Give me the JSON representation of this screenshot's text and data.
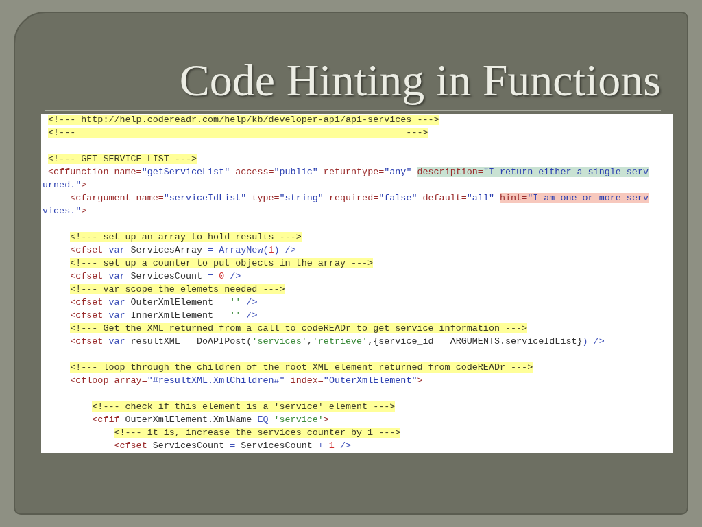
{
  "slide": {
    "title": "Code Hinting in Functions"
  },
  "code": {
    "lines": [
      {
        "segments": [
          {
            "kind": "comment",
            "text": "<!--- http://help.codereadr.com/help/kb/developer-api/api-services --->"
          }
        ]
      },
      {
        "segments": [
          {
            "kind": "comment",
            "text": "<!---                                                            --->"
          }
        ]
      },
      {
        "space_before": true,
        "segments": [
          {
            "kind": "comment",
            "text": "<!--- GET SERVICE LIST --->"
          }
        ]
      },
      {
        "segments": [
          {
            "kind": "tag",
            "text": "<cffunction "
          },
          {
            "kind": "attr",
            "text": "name="
          },
          {
            "kind": "str",
            "text": "\"getServiceList\" "
          },
          {
            "kind": "attr",
            "text": "access="
          },
          {
            "kind": "str",
            "text": "\"public\" "
          },
          {
            "kind": "attr",
            "text": "returntype="
          },
          {
            "kind": "str",
            "text": "\"any\" "
          },
          {
            "kind": "attr",
            "text": "description=",
            "color": "#c9e2d3"
          },
          {
            "kind": "str",
            "text": "\"I return either a single serv",
            "color": "#c9e2d3"
          }
        ],
        "children": [
          {
            "kind": "wrap",
            "segments": [
              {
                "kind": "str",
                "text": "urned.\""
              },
              {
                "kind": "tag",
                "text": ">"
              }
            ]
          },
          {
            "segments": [
              {
                "kind": "tag",
                "text": "<cfargument "
              },
              {
                "kind": "attr",
                "text": "name="
              },
              {
                "kind": "str",
                "text": "\"serviceIdList\" "
              },
              {
                "kind": "attr",
                "text": "type="
              },
              {
                "kind": "str",
                "text": "\"string\" "
              },
              {
                "kind": "attr",
                "text": "required="
              },
              {
                "kind": "str",
                "text": "\"false\" "
              },
              {
                "kind": "attr",
                "text": "default="
              },
              {
                "kind": "str",
                "text": "\"all\" "
              },
              {
                "kind": "attr",
                "text": "hint=",
                "color": "#f7c8bd"
              },
              {
                "kind": "str",
                "text": "\"I am one or more serv",
                "color": "#f7c8bd"
              }
            ]
          },
          {
            "kind": "wrap",
            "segments": [
              {
                "kind": "str",
                "text": "vices.\""
              },
              {
                "kind": "tag",
                "text": ">"
              }
            ]
          },
          {
            "space_before": true,
            "segments": [
              {
                "kind": "comment",
                "text": "<!--- set up an array to hold results --->"
              }
            ]
          },
          {
            "segments": [
              {
                "kind": "tag",
                "text": "<cfset "
              },
              {
                "kind": "kw",
                "text": "var "
              },
              {
                "kind": "text",
                "text": "ServicesArray "
              },
              {
                "kind": "kw",
                "text": "= ArrayNew("
              },
              {
                "kind": "num",
                "text": "1"
              },
              {
                "kind": "kw",
                "text": ") />"
              }
            ]
          },
          {
            "segments": [
              {
                "kind": "comment",
                "text": "<!--- set up a counter to put objects in the array --->"
              }
            ]
          },
          {
            "segments": [
              {
                "kind": "tag",
                "text": "<cfset "
              },
              {
                "kind": "kw",
                "text": "var "
              },
              {
                "kind": "text",
                "text": "ServicesCount "
              },
              {
                "kind": "kw",
                "text": "= "
              },
              {
                "kind": "num",
                "text": "0"
              },
              {
                "kind": "kw",
                "text": " />"
              }
            ]
          },
          {
            "segments": [
              {
                "kind": "comment",
                "text": "<!--- var scope the elemets needed --->"
              }
            ]
          },
          {
            "segments": [
              {
                "kind": "tag",
                "text": "<cfset "
              },
              {
                "kind": "kw",
                "text": "var "
              },
              {
                "kind": "text",
                "text": "OuterXmlElement "
              },
              {
                "kind": "kw",
                "text": "= "
              },
              {
                "kind": "sq",
                "text": "''"
              },
              {
                "kind": "kw",
                "text": " />"
              }
            ]
          },
          {
            "segments": [
              {
                "kind": "tag",
                "text": "<cfset "
              },
              {
                "kind": "kw",
                "text": "var "
              },
              {
                "kind": "text",
                "text": "InnerXmlElement "
              },
              {
                "kind": "kw",
                "text": "= "
              },
              {
                "kind": "sq",
                "text": "''"
              },
              {
                "kind": "kw",
                "text": " />"
              }
            ]
          },
          {
            "segments": [
              {
                "kind": "comment",
                "text": "<!--- Get the XML returned from a call to codeREADr to get service information --->"
              }
            ]
          },
          {
            "segments": [
              {
                "kind": "tag",
                "text": "<cfset "
              },
              {
                "kind": "kw",
                "text": "var "
              },
              {
                "kind": "text",
                "text": "resultXML "
              },
              {
                "kind": "kw",
                "text": "= "
              },
              {
                "kind": "text",
                "text": "DoAPIPost("
              },
              {
                "kind": "sq",
                "text": "'services'"
              },
              {
                "kind": "text",
                "text": ","
              },
              {
                "kind": "sq",
                "text": "'retrieve'"
              },
              {
                "kind": "text",
                "text": ",{service_id "
              },
              {
                "kind": "kw",
                "text": "= "
              },
              {
                "kind": "text",
                "text": "ARGUMENTS.serviceIdList}"
              },
              {
                "kind": "kw",
                "text": ") />"
              }
            ]
          },
          {
            "space_before": true,
            "segments": [
              {
                "kind": "comment",
                "text": "<!--- loop through the children of the root XML element returned from codeREADr --->"
              }
            ]
          },
          {
            "segments": [
              {
                "kind": "tag",
                "text": "<cfloop "
              },
              {
                "kind": "attr",
                "text": "array="
              },
              {
                "kind": "str",
                "text": "\"#resultXML.XmlChildren#\" "
              },
              {
                "kind": "attr",
                "text": "index="
              },
              {
                "kind": "str",
                "text": "\"OuterXmlElement\""
              },
              {
                "kind": "tag",
                "text": ">"
              }
            ],
            "children": [
              {
                "space_before": true,
                "segments": [
                  {
                    "kind": "comment",
                    "text": "<!--- check if this element is a 'service' element --->"
                  }
                ]
              },
              {
                "segments": [
                  {
                    "kind": "tag",
                    "text": "<cfif "
                  },
                  {
                    "kind": "text",
                    "text": "OuterXmlElement.XmlName "
                  },
                  {
                    "kind": "kw",
                    "text": "EQ "
                  },
                  {
                    "kind": "sq",
                    "text": "'service'"
                  },
                  {
                    "kind": "tag",
                    "text": ">"
                  }
                ],
                "children": [
                  {
                    "segments": [
                      {
                        "kind": "comment",
                        "text": "<!--- it is, increase the services counter by 1 --->"
                      }
                    ]
                  },
                  {
                    "segments": [
                      {
                        "kind": "tag",
                        "text": "<cfset "
                      },
                      {
                        "kind": "text",
                        "text": "ServicesCount "
                      },
                      {
                        "kind": "kw",
                        "text": "= "
                      },
                      {
                        "kind": "text",
                        "text": "ServicesCount "
                      },
                      {
                        "kind": "kw",
                        "text": "+ "
                      },
                      {
                        "kind": "num",
                        "text": "1"
                      },
                      {
                        "kind": "kw",
                        "text": " />"
                      }
                    ]
                  }
                ]
              }
            ]
          }
        ]
      }
    ]
  }
}
